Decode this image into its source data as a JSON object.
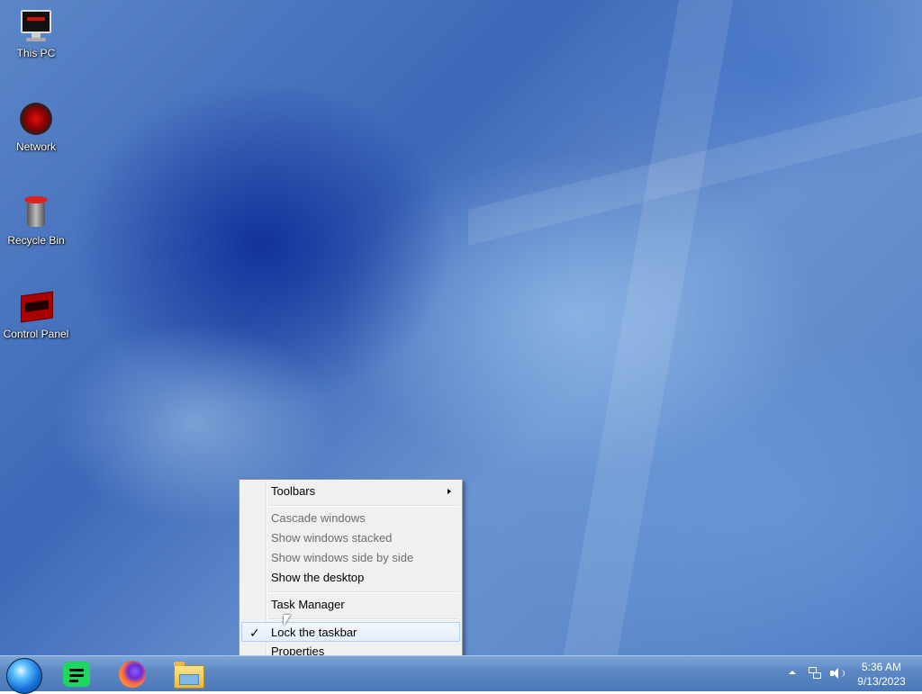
{
  "desktop": {
    "icons": [
      {
        "label": "This PC",
        "icon": "monitor-icon"
      },
      {
        "label": "Network",
        "icon": "network-globe-icon"
      },
      {
        "label": "Recycle Bin",
        "icon": "recycle-bin-icon"
      },
      {
        "label": "Control Panel",
        "icon": "control-panel-icon"
      }
    ]
  },
  "context_menu": {
    "items": [
      {
        "label": "Toolbars",
        "enabled": true,
        "submenu": true
      },
      {
        "label": "Cascade windows",
        "enabled": false
      },
      {
        "label": "Show windows stacked",
        "enabled": false
      },
      {
        "label": "Show windows side by side",
        "enabled": false
      },
      {
        "label": "Show the desktop",
        "enabled": true
      },
      {
        "label": "Task Manager",
        "enabled": true
      },
      {
        "label": "Lock the taskbar",
        "enabled": true,
        "checked": true,
        "highlighted": true
      },
      {
        "label": "Properties",
        "enabled": true
      }
    ],
    "check_mark": "✓"
  },
  "taskbar": {
    "start_button": "start-orb-icon",
    "pinned": [
      "spotify-icon",
      "firefox-icon",
      "file-explorer-icon"
    ],
    "tray": {
      "icons": [
        "show-hidden-icons-arrow",
        "network-icon",
        "volume-icon"
      ],
      "time": "5:36 AM",
      "date": "9/13/2023"
    }
  },
  "colors": {
    "wallpaper_base": "#4d7cc4",
    "menu_background": "#f0f0f0",
    "menu_highlight_border": "#aecff7",
    "disabled_text": "#6d6d6d"
  }
}
